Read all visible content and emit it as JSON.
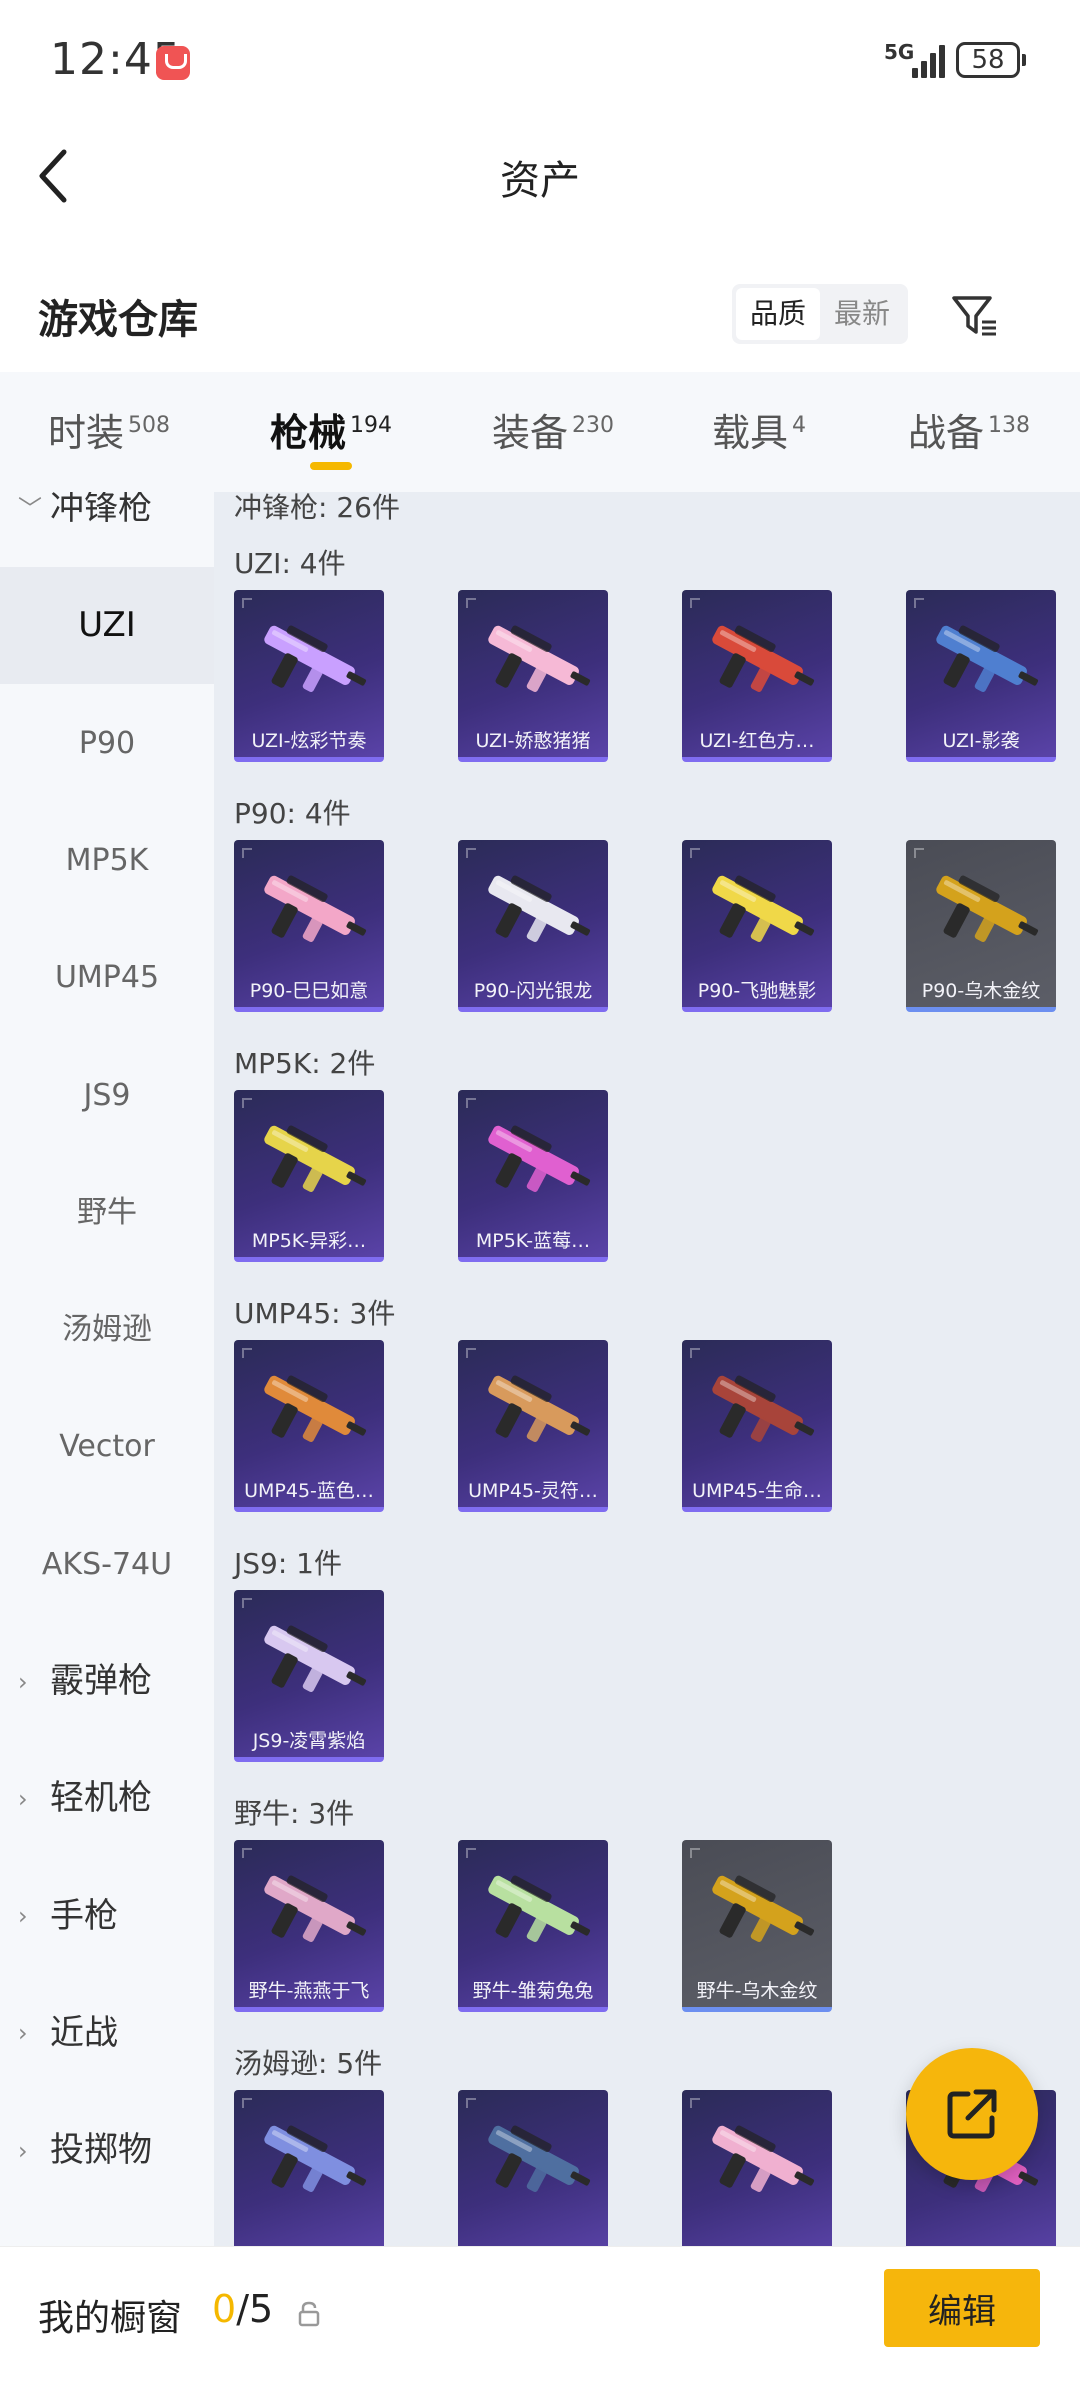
{
  "status_bar": {
    "time": "12:45",
    "network": "5G",
    "battery": "58"
  },
  "header": {
    "title": "资产"
  },
  "section": {
    "title": "游戏仓库",
    "sort_options": [
      "品质",
      "最新"
    ]
  },
  "tabs": [
    {
      "label": "时装",
      "count": "508"
    },
    {
      "label": "枪械",
      "count": "194"
    },
    {
      "label": "装备",
      "count": "230"
    },
    {
      "label": "载具",
      "count": "4"
    },
    {
      "label": "战备",
      "count": "138"
    }
  ],
  "sidebar": {
    "items": [
      {
        "label": "冲锋枪",
        "type": "category",
        "chevron": "﹀"
      },
      {
        "label": "UZI"
      },
      {
        "label": "P90"
      },
      {
        "label": "MP5K"
      },
      {
        "label": "UMP45"
      },
      {
        "label": "JS9"
      },
      {
        "label": "野牛"
      },
      {
        "label": "汤姆逊"
      },
      {
        "label": "Vector"
      },
      {
        "label": "AKS-74U"
      },
      {
        "label": "霰弹枪",
        "type": "category",
        "chevron": "›"
      },
      {
        "label": "轻机枪",
        "type": "category",
        "chevron": "›"
      },
      {
        "label": "手枪",
        "type": "category",
        "chevron": "›"
      },
      {
        "label": "近战",
        "type": "category",
        "chevron": "›"
      },
      {
        "label": "投掷物",
        "type": "category",
        "chevron": "›"
      }
    ]
  },
  "main": {
    "category_header": "冲锋枪: 26件",
    "groups": [
      {
        "label": "UZI: 4件",
        "items": [
          {
            "name": "UZI-炫彩节奏",
            "color": "#c9a0ff"
          },
          {
            "name": "UZI-娇憨猪猪",
            "color": "#f6b9d6"
          },
          {
            "name": "UZI-红色方…",
            "color": "#d94a3a"
          },
          {
            "name": "UZI-影袭",
            "color": "#4f7fd0"
          }
        ]
      },
      {
        "label": "P90: 4件",
        "items": [
          {
            "name": "P90-巳巳如意",
            "color": "#f3a7c8"
          },
          {
            "name": "P90-闪光银龙",
            "color": "#e8e8f0"
          },
          {
            "name": "P90-飞驰魅影",
            "color": "#f0d848"
          },
          {
            "name": "P90-乌木金纹",
            "color": "#d4a21c",
            "gray": true
          }
        ]
      },
      {
        "label": "MP5K: 2件",
        "items": [
          {
            "name": "MP5K-异彩…",
            "color": "#e6d44a"
          },
          {
            "name": "MP5K-蓝莓…",
            "color": "#e060d0"
          }
        ]
      },
      {
        "label": "UMP45: 3件",
        "items": [
          {
            "name": "UMP45-蓝色…",
            "color": "#e08a3a"
          },
          {
            "name": "UMP45-灵符…",
            "color": "#d89a5c"
          },
          {
            "name": "UMP45-生命…",
            "color": "#a8443a"
          }
        ]
      },
      {
        "label": "JS9: 1件",
        "items": [
          {
            "name": "JS9-凌霄紫焰",
            "color": "#d8c8f0"
          }
        ]
      },
      {
        "label": "野牛: 3件",
        "items": [
          {
            "name": "野牛-燕燕于飞",
            "color": "#e0a8c8"
          },
          {
            "name": "野牛-雏菊兔兔",
            "color": "#b8e0a0"
          },
          {
            "name": "野牛-乌木金纹",
            "color": "#d4a21c",
            "gray": true
          }
        ]
      },
      {
        "label": "汤姆逊: 5件",
        "items": [
          {
            "name": "",
            "color": "#7f8fe0"
          },
          {
            "name": "",
            "color": "#4f6fa0"
          },
          {
            "name": "",
            "color": "#f0b0d0"
          },
          {
            "name": "",
            "color": "#e060c0"
          }
        ]
      }
    ]
  },
  "bottom_bar": {
    "label": "我的橱窗",
    "count_current": "0",
    "count_sep_total": "/5",
    "edit_label": "编辑"
  }
}
